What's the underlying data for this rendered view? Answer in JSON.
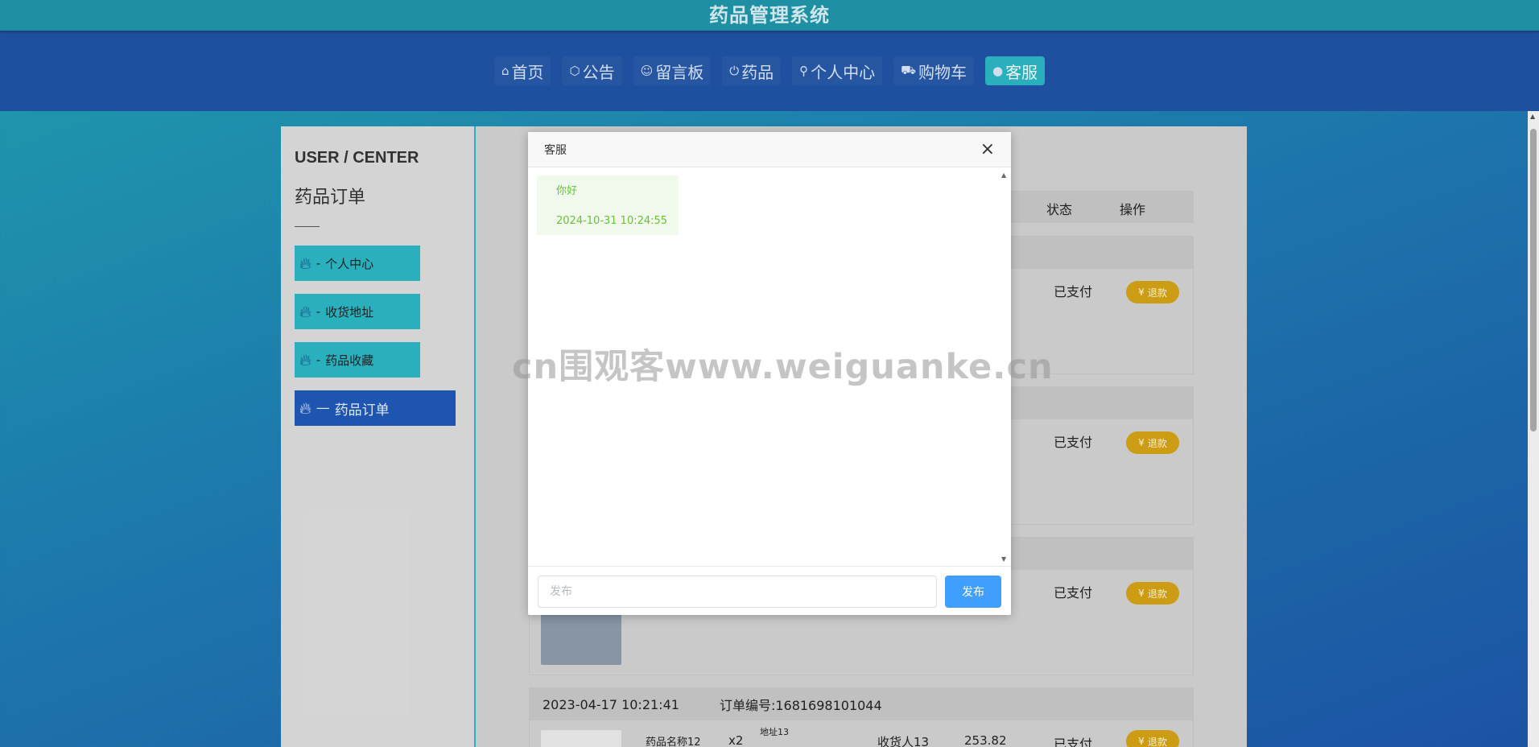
{
  "app": {
    "title": "药品管理系统"
  },
  "nav": {
    "items": [
      {
        "label": "首页",
        "icon": "home-icon",
        "glyph": "⌂"
      },
      {
        "label": "公告",
        "icon": "box-icon",
        "glyph": "⬡"
      },
      {
        "label": "留言板",
        "icon": "message-icon",
        "glyph": "☺"
      },
      {
        "label": "药品",
        "icon": "power-icon",
        "glyph": "⏻"
      },
      {
        "label": "个人中心",
        "icon": "user-icon",
        "glyph": "⚲"
      },
      {
        "label": "购物车",
        "icon": "cart-icon",
        "glyph": "⛟"
      },
      {
        "label": "客服",
        "icon": "chat-icon",
        "glyph": "●"
      }
    ],
    "active_index": 6
  },
  "sidebar": {
    "title": "USER / CENTER",
    "subtitle": "药品订单",
    "items": [
      {
        "label": "个人中心",
        "prefix": "-"
      },
      {
        "label": "收货地址",
        "prefix": "-"
      },
      {
        "label": "药品收藏",
        "prefix": "-"
      },
      {
        "label": "药品订单",
        "prefix": "—"
      }
    ]
  },
  "table": {
    "headers": {
      "status": "状态",
      "action": "操作"
    },
    "orders": [
      {
        "status": "已支付",
        "action": "退款"
      },
      {
        "status": "已支付",
        "action": "退款"
      },
      {
        "status": "已支付",
        "action": "退款"
      },
      {
        "status": "已支付",
        "action": "退款",
        "time": "2023-04-17 10:21:41",
        "order_no": "订单编号:1681698101044",
        "product": "药品名称12",
        "qty": "x2",
        "address": "地址13",
        "receiver": "收货人13",
        "price": "253.82"
      }
    ]
  },
  "dialog": {
    "title": "客服",
    "messages": [
      {
        "text": "你好",
        "time": "2024-10-31 10:24:55"
      }
    ],
    "input_placeholder": "发布",
    "send_label": "发布"
  },
  "watermark": "cn围观客www.weiguanke.cn"
}
